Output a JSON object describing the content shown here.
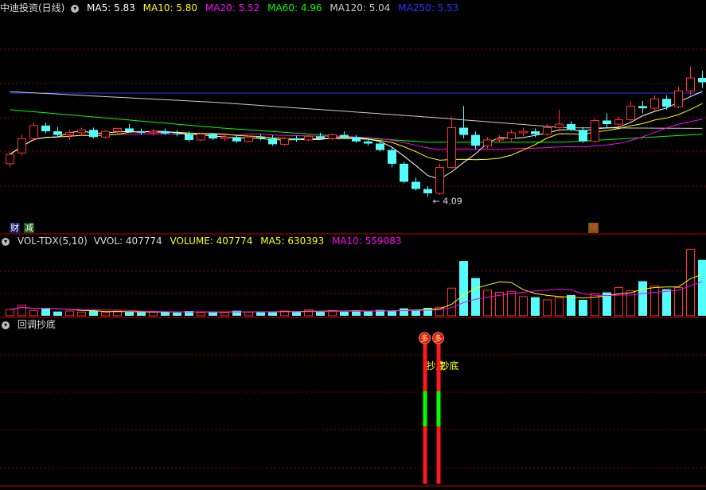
{
  "colors": {
    "up": "#ff3232",
    "down": "#54fcfc",
    "ma5": "#ffffff",
    "ma10": "#ffff00",
    "ma20": "#ff00ff",
    "ma60": "#00ff00",
    "ma120": "#cccccc",
    "ma250": "#3030ff",
    "grid": "#8b0000"
  },
  "main": {
    "title": "中迪投资(日线)",
    "ma": [
      {
        "label": "MA5: 5.83",
        "color": "#ffffff"
      },
      {
        "label": "MA10: 5.80",
        "color": "#ffff00"
      },
      {
        "label": "MA20: 5.52",
        "color": "#ff00ff"
      },
      {
        "label": "MA60: 4.96",
        "color": "#00ff00"
      },
      {
        "label": "MA120: 5.04",
        "color": "#cccccc"
      },
      {
        "label": "MA250: 5.53",
        "color": "#3030ff"
      }
    ],
    "tags": {
      "cai": "财",
      "jian": "减",
      "yu": "预"
    },
    "low_label": "4.09"
  },
  "volume": {
    "title": "VOL-TDX(5,10)",
    "items": [
      {
        "label": "VVOL: 407774",
        "color": "#dddddd"
      },
      {
        "label": "VOLUME: 407774",
        "color": "#ffff00"
      },
      {
        "label": "MA5: 630393",
        "color": "#ffff00"
      },
      {
        "label": "MA10: 559083",
        "color": "#ff00ff"
      }
    ]
  },
  "indicator": {
    "title": "回调抄底",
    "signal_text": "抄底",
    "marker_text": "多"
  },
  "chart_data": [
    {
      "type": "candlestick",
      "title": "中迪投资(日线)",
      "low_annotation": 4.09,
      "ohlc": [
        [
          4.55,
          4.72,
          4.5,
          4.68
        ],
        [
          4.7,
          4.95,
          4.66,
          4.9
        ],
        [
          4.9,
          5.12,
          4.86,
          5.08
        ],
        [
          5.08,
          5.12,
          4.97,
          5.0
        ],
        [
          5.0,
          5.06,
          4.92,
          4.95
        ],
        [
          4.95,
          5.02,
          4.88,
          4.98
        ],
        [
          4.98,
          5.05,
          4.94,
          5.02
        ],
        [
          5.02,
          5.05,
          4.9,
          4.92
        ],
        [
          4.92,
          5.02,
          4.9,
          5.0
        ],
        [
          5.0,
          5.05,
          4.96,
          5.04
        ],
        [
          5.04,
          5.1,
          4.98,
          5.0
        ],
        [
          5.0,
          5.04,
          4.95,
          4.98
        ],
        [
          4.98,
          5.03,
          4.94,
          5.0
        ],
        [
          5.0,
          5.04,
          4.95,
          4.97
        ],
        [
          4.97,
          5.02,
          4.93,
          4.96
        ],
        [
          4.96,
          5.0,
          4.85,
          4.88
        ],
        [
          4.88,
          4.98,
          4.86,
          4.96
        ],
        [
          4.96,
          4.98,
          4.88,
          4.9
        ],
        [
          4.9,
          4.96,
          4.86,
          4.92
        ],
        [
          4.92,
          4.95,
          4.84,
          4.86
        ],
        [
          4.86,
          4.94,
          4.85,
          4.92
        ],
        [
          4.92,
          4.96,
          4.88,
          4.9
        ],
        [
          4.9,
          4.95,
          4.8,
          4.82
        ],
        [
          4.82,
          4.92,
          4.8,
          4.9
        ],
        [
          4.9,
          4.94,
          4.85,
          4.88
        ],
        [
          4.88,
          4.95,
          4.86,
          4.93
        ],
        [
          4.93,
          4.98,
          4.88,
          4.9
        ],
        [
          4.9,
          4.97,
          4.88,
          4.95
        ],
        [
          4.95,
          5.0,
          4.9,
          4.92
        ],
        [
          4.92,
          4.95,
          4.84,
          4.86
        ],
        [
          4.86,
          4.9,
          4.8,
          4.83
        ],
        [
          4.83,
          4.88,
          4.72,
          4.74
        ],
        [
          4.74,
          4.78,
          4.5,
          4.55
        ],
        [
          4.55,
          4.58,
          4.28,
          4.3
        ],
        [
          4.3,
          4.36,
          4.18,
          4.2
        ],
        [
          4.2,
          4.24,
          4.09,
          4.14
        ],
        [
          4.14,
          4.55,
          4.12,
          4.5
        ],
        [
          4.5,
          5.2,
          4.48,
          5.05
        ],
        [
          5.05,
          5.35,
          4.9,
          4.95
        ],
        [
          4.95,
          5.0,
          4.75,
          4.8
        ],
        [
          4.8,
          4.92,
          4.76,
          4.88
        ],
        [
          4.88,
          4.95,
          4.84,
          4.9
        ],
        [
          4.9,
          5.02,
          4.86,
          4.98
        ],
        [
          4.98,
          5.05,
          4.93,
          5.0
        ],
        [
          5.0,
          5.04,
          4.92,
          4.96
        ],
        [
          4.96,
          5.1,
          4.94,
          5.05
        ],
        [
          5.05,
          5.3,
          5.0,
          5.1
        ],
        [
          5.1,
          5.14,
          5.0,
          5.02
        ],
        [
          5.02,
          5.06,
          4.84,
          4.86
        ],
        [
          4.86,
          5.18,
          4.84,
          5.15
        ],
        [
          5.15,
          5.25,
          5.05,
          5.1
        ],
        [
          5.1,
          5.2,
          5.06,
          5.16
        ],
        [
          5.16,
          5.42,
          5.12,
          5.35
        ],
        [
          5.35,
          5.42,
          5.25,
          5.32
        ],
        [
          5.32,
          5.5,
          5.28,
          5.45
        ],
        [
          5.45,
          5.5,
          5.3,
          5.34
        ],
        [
          5.34,
          5.62,
          5.32,
          5.56
        ],
        [
          5.56,
          5.9,
          5.5,
          5.74
        ],
        [
          5.74,
          5.84,
          5.6,
          5.68
        ]
      ]
    },
    {
      "type": "bar",
      "title": "VOL-TDX(5,10)",
      "values": [
        120,
        200,
        100,
        150,
        80,
        90,
        70,
        95,
        60,
        85,
        70,
        65,
        75,
        80,
        60,
        90,
        60,
        70,
        60,
        95,
        70,
        75,
        70,
        90,
        80,
        110,
        75,
        95,
        80,
        100,
        85,
        110,
        90,
        140,
        115,
        150,
        160,
        520,
        1030,
        710,
        480,
        440,
        460,
        360,
        350,
        300,
        340,
        390,
        300,
        420,
        440,
        530,
        470,
        650,
        560,
        500,
        530,
        1250,
        1050
      ],
      "ylim": [
        0,
        1300
      ]
    },
    {
      "type": "signal",
      "title": "回调抄底",
      "signals": [
        {
          "bar": 35,
          "label": "抄底"
        },
        {
          "bar": 36,
          "label": "抄底"
        }
      ]
    }
  ]
}
